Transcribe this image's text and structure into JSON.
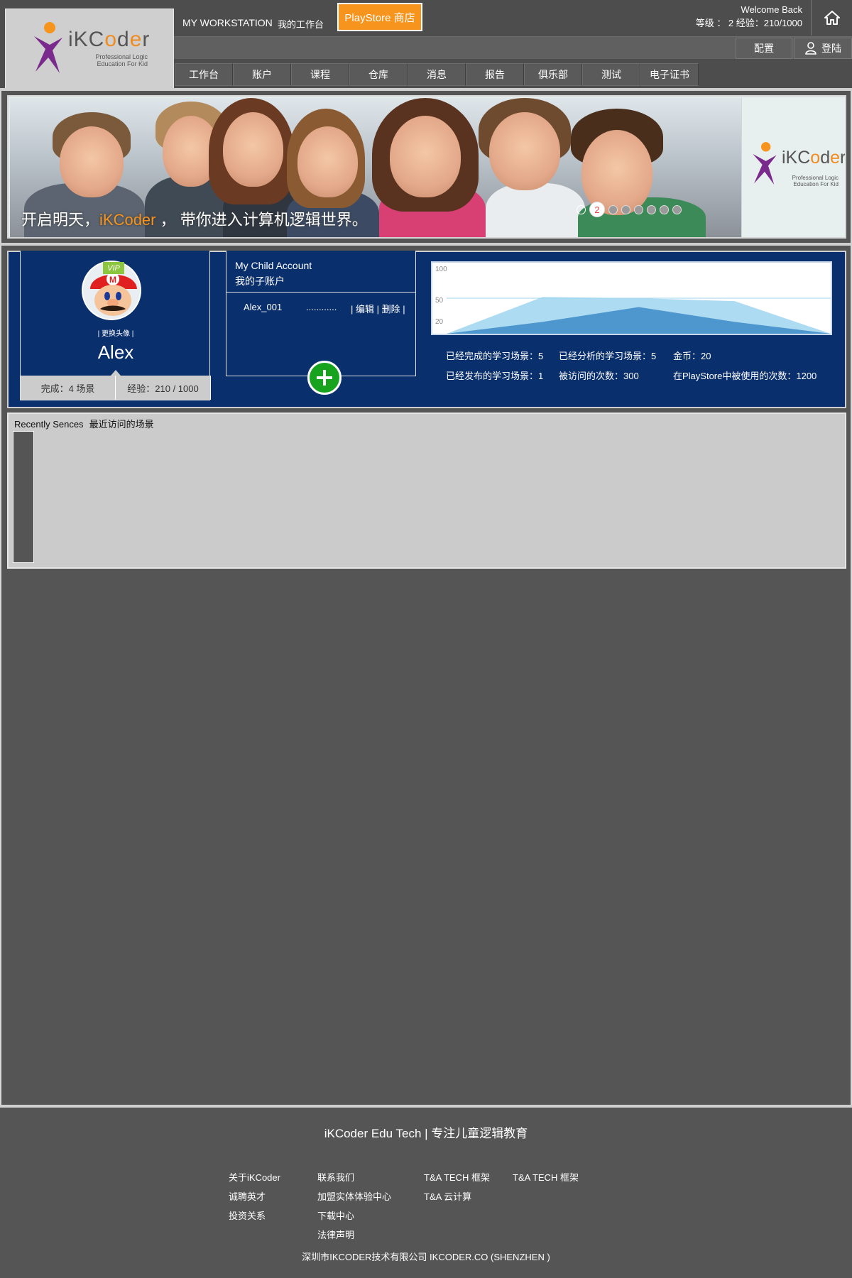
{
  "brand": {
    "name_prefix": "iKC",
    "name_o": "o",
    "name_mid": "d",
    "name_e": "e",
    "name_suffix": "r",
    "tagline_1": "Professional Logic",
    "tagline_2": "Education For Kid"
  },
  "header": {
    "workstation_en": "MY WORKSTATION",
    "workstation_cn": "我的工作台",
    "playstore_label": "PlayStore 商店",
    "welcome": "Welcome Back",
    "level_line": "等级 ： 2  经验：210/1000",
    "config_label": "配置",
    "login_label": "登陆"
  },
  "nav": [
    "工作台",
    "账户",
    "课程",
    "仓库",
    "消息",
    "报告",
    "俱乐部",
    "测试",
    "电子证书"
  ],
  "banner": {
    "text_before": "开启明天，",
    "text_highlight": "iKCoder",
    "text_after": " ，  带你进入计算机逻辑世界。",
    "active_slide": "2",
    "slide_count": 9
  },
  "profile": {
    "vip": "VIP",
    "change_avatar": "| 更换头像 |",
    "name": "Alex",
    "completed": "完成：4 场景",
    "experience": "经验：210 / 1000"
  },
  "child_account": {
    "title_en": "My Child Account",
    "title_cn": "我的子账户",
    "row_name": "Alex_001",
    "row_mask": "............",
    "row_actions": "| 编辑 | 删除 |"
  },
  "chart_data": {
    "type": "area",
    "y_ticks": [
      "100",
      "50",
      "20"
    ],
    "ylim": [
      0,
      120
    ],
    "series": [
      {
        "values": [
          0,
          62,
          60,
          55,
          0
        ]
      },
      {
        "values": [
          0,
          20,
          45,
          20,
          0
        ]
      }
    ],
    "colors": [
      "#9fd5ee",
      "#2f7fc1"
    ]
  },
  "stats": {
    "completed_scenes": "已经完成的学习场景：5",
    "analyzed_scenes": "已经分析的学习场景：5",
    "coins": "金币：20",
    "published_scenes": "已经发布的学习场景：1",
    "visits": "被访问的次数：300",
    "playstore_uses": "在PlayStore中被使用的次数：1200"
  },
  "recent": {
    "title_en": "Recently Sences",
    "title_cn": "最近访问的场景"
  },
  "footer": {
    "brand": "iKCoder Edu Tech | 专注儿童逻辑教育",
    "col1": [
      "关于iKCoder",
      "诚聘英才",
      "投资关系"
    ],
    "col2": [
      "联系我们",
      "加盟实体体验中心",
      "下载中心",
      "法律声明"
    ],
    "col3": [
      "T&A TECH 框架",
      "T&A 云计算"
    ],
    "col4": [
      "T&A TECH 框架"
    ],
    "copyright": "深圳市IKCODER技术有限公司 IKCODER.CO (SHENZHEN )"
  },
  "colors": {
    "accent": "#f7941d",
    "panel_blue": "#0a2f6d",
    "add_green": "#18a31f",
    "logo_purple": "#7a2a8c"
  },
  "icons": {
    "home": "home-icon",
    "user": "user-icon",
    "plus": "plus-icon"
  }
}
